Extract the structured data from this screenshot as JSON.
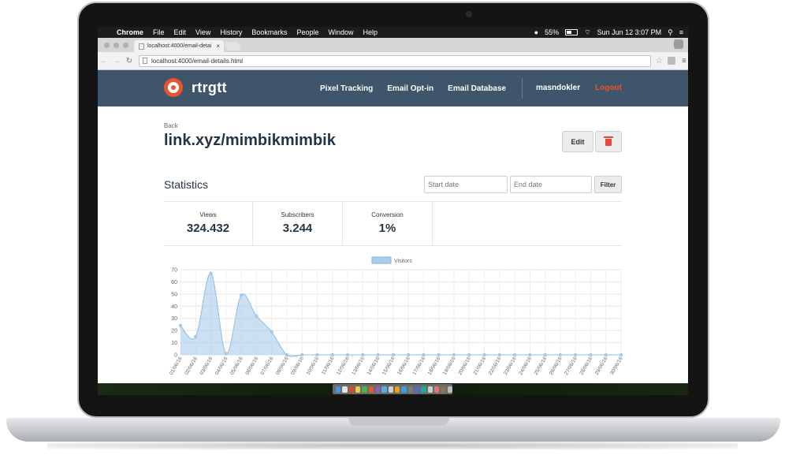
{
  "menubar": {
    "app_name": "Chrome",
    "items": [
      "File",
      "Edit",
      "View",
      "History",
      "Bookmarks",
      "People",
      "Window",
      "Help"
    ],
    "battery": "55%",
    "datetime": "Sun Jun 12  3:07 PM"
  },
  "browser": {
    "tab_title": "localhost:4000/email-detai",
    "url": "localhost:4000/email-details.html"
  },
  "site": {
    "logo_text": "rtrgtt",
    "nav": [
      "Pixel Tracking",
      "Email Opt-in",
      "Email Database"
    ],
    "user": "masndokler",
    "logout": "Logout",
    "accent_color": "#e8542f",
    "nav_bg": "#3f556b"
  },
  "page": {
    "back": "Back",
    "title": "link.xyz/mimbikmimbik",
    "edit": "Edit",
    "statistics": "Statistics",
    "start_date_placeholder": "Start date",
    "end_date_placeholder": "End date",
    "filter": "Filter",
    "stats": [
      {
        "label": "Views",
        "value": "324.432"
      },
      {
        "label": "Subscribers",
        "value": "3.244"
      },
      {
        "label": "Conversion",
        "value": "1%"
      }
    ]
  },
  "chart_data": {
    "type": "area",
    "series": [
      {
        "name": "Visitors",
        "values": [
          24,
          15,
          67,
          1,
          49,
          32,
          19,
          0,
          0,
          0,
          0,
          0,
          0,
          0,
          0,
          0,
          0,
          0,
          0,
          0,
          0,
          0,
          0,
          0,
          0,
          0,
          0,
          0,
          0,
          0
        ]
      }
    ],
    "x": [
      "01/06/16",
      "02/06/16",
      "03/06/16",
      "04/06/16",
      "05/06/16",
      "06/06/16",
      "07/06/16",
      "08/06/16",
      "09/06/16",
      "10/06/16",
      "11/06/16",
      "12/06/16",
      "13/06/16",
      "14/06/16",
      "15/06/16",
      "16/06/16",
      "17/06/16",
      "18/06/16",
      "19/06/16",
      "20/06/16",
      "21/06/16",
      "22/06/16",
      "23/06/16",
      "24/06/16",
      "25/06/16",
      "26/06/16",
      "27/06/16",
      "28/06/16",
      "29/06/16",
      "30/06/16"
    ],
    "yticks": [
      0,
      10,
      20,
      30,
      40,
      50,
      60,
      70
    ],
    "ylim": [
      0,
      70
    ],
    "legend": "top-center",
    "grid": true,
    "color": "#a9cdeb"
  }
}
